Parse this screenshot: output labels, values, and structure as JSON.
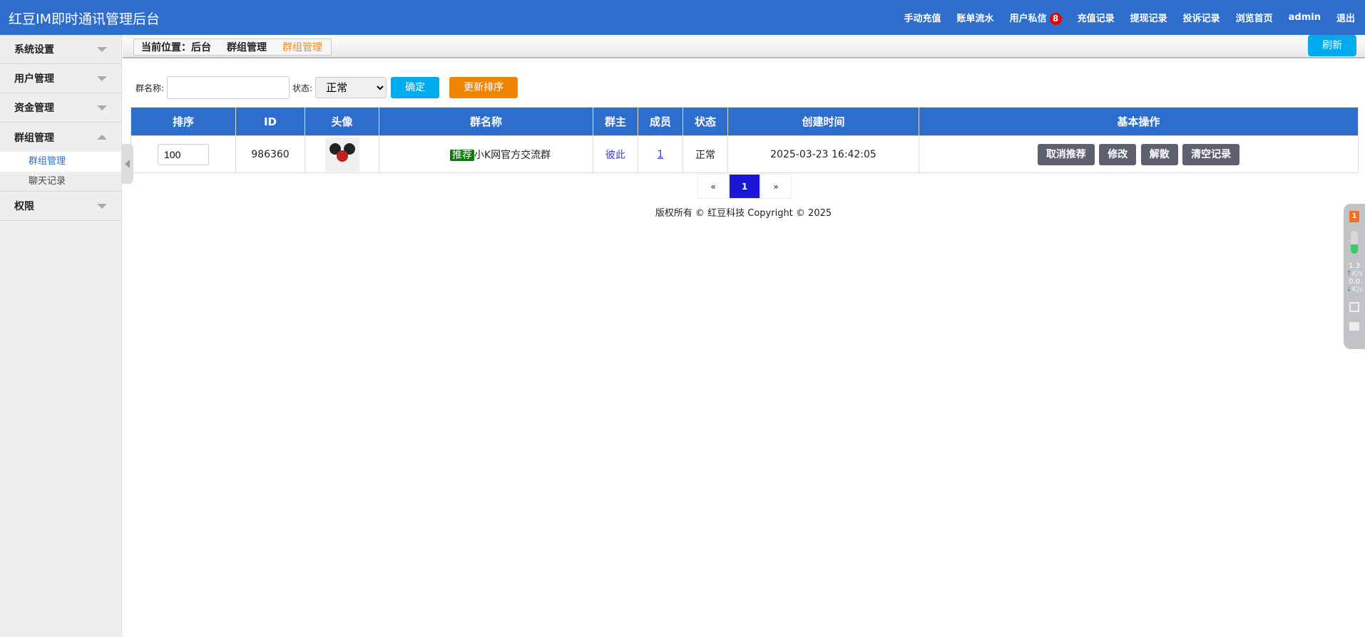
{
  "header": {
    "title": "红豆IM即时通讯管理后台",
    "nav": [
      "手动充值",
      "账单流水",
      "用户私信",
      "充值记录",
      "提现记录",
      "投诉记录",
      "浏览首页",
      "admin",
      "退出"
    ],
    "unread": "8"
  },
  "sidebar": {
    "sections": [
      {
        "label": "系统设置"
      },
      {
        "label": "用户管理"
      },
      {
        "label": "资金管理"
      },
      {
        "label": "群组管理",
        "items": [
          "群组管理",
          "聊天记录"
        ]
      },
      {
        "label": "权限"
      }
    ]
  },
  "breadcrumb": [
    "当前位置：后台",
    "群组管理",
    "群组管理"
  ],
  "refresh": "刷新",
  "filter": {
    "name_label": "群名称:",
    "name_value": "",
    "status_label": "状态:",
    "status_value": "正常",
    "confirm": "确定",
    "update_sort": "更新排序"
  },
  "table": {
    "headers": [
      "排序",
      "ID",
      "头像",
      "群名称",
      "群主",
      "成员",
      "状态",
      "创建时间",
      "基本操作"
    ],
    "rows": [
      {
        "sort": "100",
        "id": "986360",
        "tag": "推荐",
        "name": "小K网官方交流群",
        "owner": "彼此",
        "members": "1",
        "status": "正常",
        "created": "2025-03-23 16:42:05",
        "actions": [
          "取消推荐",
          "修改",
          "解散",
          "清空记录"
        ]
      }
    ]
  },
  "pager": {
    "prev": "«",
    "current": "1",
    "next": "»"
  },
  "footer": "版权所有 © 红豆科技 Copyright © 2025",
  "widget": {
    "badge": "1",
    "up": "1.3",
    "down": "0.0",
    "unit": "K/s"
  }
}
